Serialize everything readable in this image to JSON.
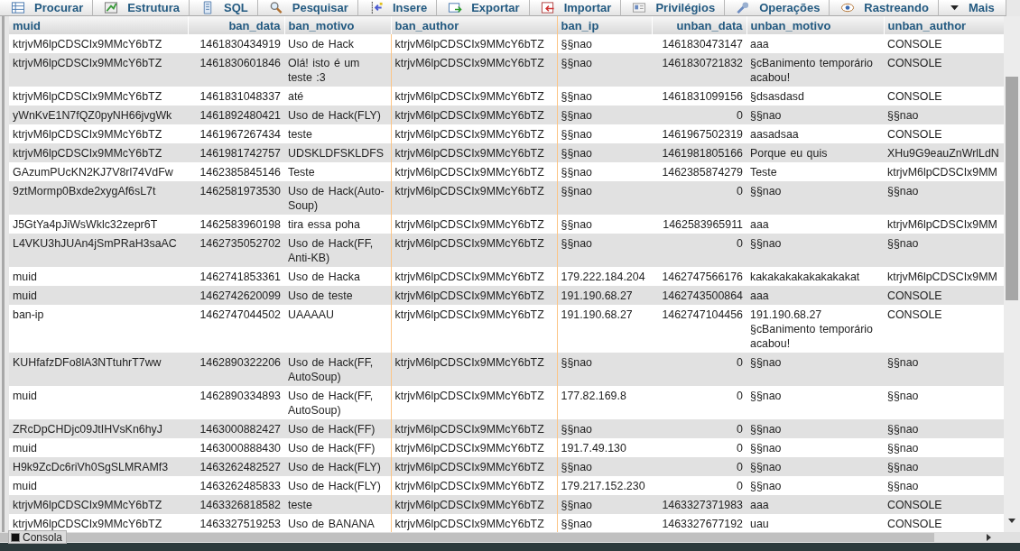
{
  "tabs": [
    {
      "label": "Procurar"
    },
    {
      "label": "Estrutura"
    },
    {
      "label": "SQL"
    },
    {
      "label": "Pesquisar"
    },
    {
      "label": "Insere"
    },
    {
      "label": "Exportar"
    },
    {
      "label": "Importar"
    },
    {
      "label": "Privilégios"
    },
    {
      "label": "Operações"
    },
    {
      "label": "Rastreando"
    },
    {
      "label": "Mais"
    }
  ],
  "table": {
    "columns": [
      {
        "label": "muid",
        "kind": "text",
        "highlighted": false
      },
      {
        "label": "ban_data",
        "kind": "number",
        "highlighted": false
      },
      {
        "label": "ban_motivo",
        "kind": "text",
        "highlighted": false
      },
      {
        "label": "ban_author",
        "kind": "text",
        "highlighted": true
      },
      {
        "label": "ban_ip",
        "kind": "text",
        "highlighted": false
      },
      {
        "label": "unban_data",
        "kind": "number",
        "highlighted": false
      },
      {
        "label": "unban_motivo",
        "kind": "text",
        "highlighted": false
      },
      {
        "label": "unban_author",
        "kind": "text",
        "highlighted": false
      }
    ],
    "rows": [
      [
        "ktrjvM6lpCDSCIx9MMcY6bTZ",
        "1461830434919",
        "Uso de Hack",
        "ktrjvM6lpCDSCIx9MMcY6bTZ",
        "§§nao",
        "1461830473147",
        "aaa",
        "CONSOLE"
      ],
      [
        "ktrjvM6lpCDSCIx9MMcY6bTZ",
        "1461830601846",
        "Olá! isto é um teste :3",
        "ktrjvM6lpCDSCIx9MMcY6bTZ",
        "§§nao",
        "1461830721832",
        "§cBanimento temporário acabou!",
        "CONSOLE"
      ],
      [
        "ktrjvM6lpCDSCIx9MMcY6bTZ",
        "1461831048337",
        "até",
        "ktrjvM6lpCDSCIx9MMcY6bTZ",
        "§§nao",
        "1461831099156",
        "§dsasdasd",
        "CONSOLE"
      ],
      [
        "yWnKvE1N7fQZ0pyNH66jvgWk",
        "1461892480421",
        "Uso de Hack(FLY)",
        "ktrjvM6lpCDSCIx9MMcY6bTZ",
        "§§nao",
        "0",
        "§§nao",
        "§§nao"
      ],
      [
        "ktrjvM6lpCDSCIx9MMcY6bTZ",
        "1461967267434",
        "teste",
        "ktrjvM6lpCDSCIx9MMcY6bTZ",
        "§§nao",
        "1461967502319",
        "aasadsaa",
        "CONSOLE"
      ],
      [
        "ktrjvM6lpCDSCIx9MMcY6bTZ",
        "1461981742757",
        "UDSKLDFSKLDFS",
        "ktrjvM6lpCDSCIx9MMcY6bTZ",
        "§§nao",
        "1461981805166",
        "Porque eu quis",
        "XHu9G9eauZnWrlLdN"
      ],
      [
        "GAzumPUcKN2KJ7V8rl74VdFw",
        "1462385845146",
        "Teste",
        "ktrjvM6lpCDSCIx9MMcY6bTZ",
        "§§nao",
        "1462385874279",
        "Teste",
        "ktrjvM6lpCDSCIx9MM"
      ],
      [
        "9ztMormp0Bxde2xygAf6sL7t",
        "1462581973530",
        "Uso de Hack(Auto-Soup)",
        "ktrjvM6lpCDSCIx9MMcY6bTZ",
        "§§nao",
        "0",
        "§§nao",
        "§§nao"
      ],
      [
        "J5GtYa4pJiWsWklc32zepr6T",
        "1462583960198",
        "tira essa poha",
        "ktrjvM6lpCDSCIx9MMcY6bTZ",
        "§§nao",
        "1462583965911",
        "aaa",
        "ktrjvM6lpCDSCIx9MM"
      ],
      [
        "L4VKU3hJUAn4jSmPRaH3saAC",
        "1462735052702",
        "Uso de Hack(FF, Anti-KB)",
        "ktrjvM6lpCDSCIx9MMcY6bTZ",
        "§§nao",
        "0",
        "§§nao",
        "§§nao"
      ],
      [
        "muid",
        "1462741853361",
        "Uso de Hacka",
        "ktrjvM6lpCDSCIx9MMcY6bTZ",
        "179.222.184.204",
        "1462747566176",
        "kakakakakakakakakat",
        "ktrjvM6lpCDSCIx9MM"
      ],
      [
        "muid",
        "1462742620099",
        "Uso de teste",
        "ktrjvM6lpCDSCIx9MMcY6bTZ",
        "191.190.68.27",
        "1462743500864",
        "aaa",
        "CONSOLE"
      ],
      [
        "ban-ip",
        "1462747044502",
        "UAAAAU",
        "ktrjvM6lpCDSCIx9MMcY6bTZ",
        "191.190.68.27",
        "1462747104456",
        "191.190.68.27 §cBanimento temporário acabou!",
        "CONSOLE"
      ],
      [
        "KUHfafzDFo8lA3NTtuhrT7ww",
        "1462890322206",
        "Uso de Hack(FF, AutoSoup)",
        "ktrjvM6lpCDSCIx9MMcY6bTZ",
        "§§nao",
        "0",
        "§§nao",
        "§§nao"
      ],
      [
        "muid",
        "1462890334893",
        "Uso de Hack(FF, AutoSoup)",
        "ktrjvM6lpCDSCIx9MMcY6bTZ",
        "177.82.169.8",
        "0",
        "§§nao",
        "§§nao"
      ],
      [
        "ZRcDpCHDjc09JtIHVsKn6hyJ",
        "1463000882427",
        "Uso de Hack(FF)",
        "ktrjvM6lpCDSCIx9MMcY6bTZ",
        "§§nao",
        "0",
        "§§nao",
        "§§nao"
      ],
      [
        "muid",
        "1463000888430",
        "Uso de Hack(FF)",
        "ktrjvM6lpCDSCIx9MMcY6bTZ",
        "191.7.49.130",
        "0",
        "§§nao",
        "§§nao"
      ],
      [
        "H9k9ZcDc6riVh0SgSLMRAMf3",
        "1463262482527",
        "Uso de Hack(FLY)",
        "ktrjvM6lpCDSCIx9MMcY6bTZ",
        "§§nao",
        "0",
        "§§nao",
        "§§nao"
      ],
      [
        "muid",
        "1463262485833",
        "Uso de Hack(FLY)",
        "ktrjvM6lpCDSCIx9MMcY6bTZ",
        "179.217.152.230",
        "0",
        "§§nao",
        "§§nao"
      ],
      [
        "ktrjvM6lpCDSCIx9MMcY6bTZ",
        "1463326818582",
        "teste",
        "ktrjvM6lpCDSCIx9MMcY6bTZ",
        "§§nao",
        "1463327371983",
        "aaa",
        "CONSOLE"
      ],
      [
        "ktrjvM6lpCDSCIx9MMcY6bTZ",
        "1463327519253",
        "Uso de BANANA",
        "ktrjvM6lpCDSCIx9MMcY6bTZ",
        "§§nao",
        "1463327677192",
        "uau",
        "CONSOLE"
      ]
    ]
  },
  "console_tab": {
    "label": "Consola"
  }
}
